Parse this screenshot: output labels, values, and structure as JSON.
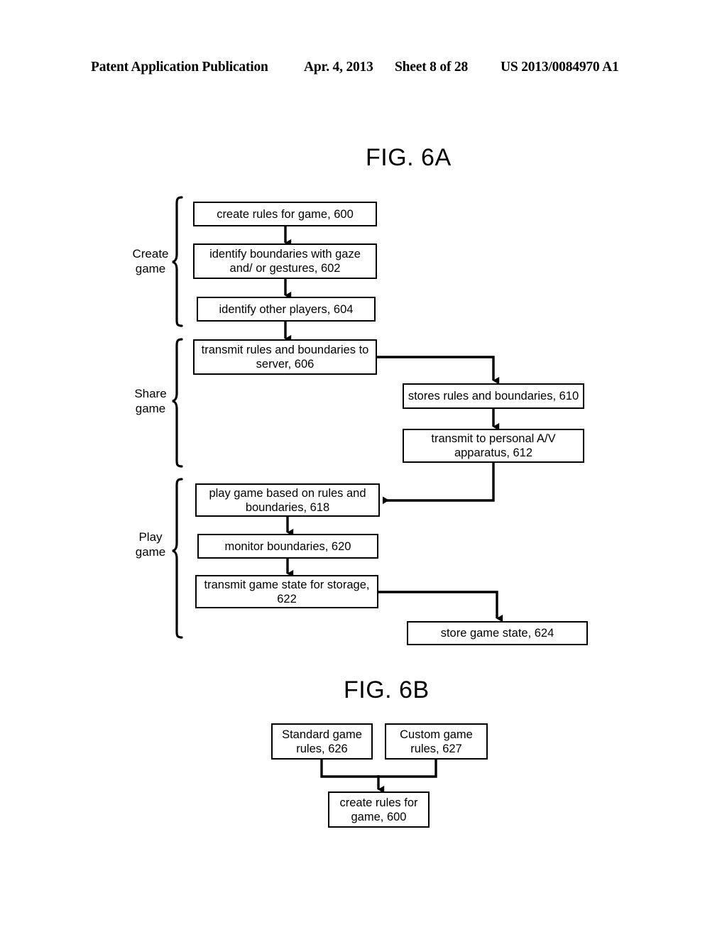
{
  "header": {
    "publication": "Patent Application Publication",
    "date": "Apr. 4, 2013",
    "sheet": "Sheet 8 of 28",
    "number": "US 2013/0084970 A1"
  },
  "figures": [
    {
      "id": "fig-6a",
      "title": "FIG. 6A",
      "groups": [
        {
          "id": "create-game",
          "label": "Create\ngame"
        },
        {
          "id": "share-game",
          "label": "Share\ngame"
        },
        {
          "id": "play-game",
          "label": "Play\ngame"
        }
      ],
      "boxes": [
        {
          "id": "box-600",
          "ref": "600",
          "text": "create rules for game, 600"
        },
        {
          "id": "box-602",
          "ref": "602",
          "text": "identify boundaries with gaze and/ or gestures, 602"
        },
        {
          "id": "box-604",
          "ref": "604",
          "text": "identify other players, 604"
        },
        {
          "id": "box-606",
          "ref": "606",
          "text": "transmit rules and boundaries to server, 606"
        },
        {
          "id": "box-610",
          "ref": "610",
          "text": "stores rules and boundaries, 610"
        },
        {
          "id": "box-612",
          "ref": "612",
          "text": "transmit to personal A/V apparatus, 612"
        },
        {
          "id": "box-618",
          "ref": "618",
          "text": "play game based on rules and boundaries, 618"
        },
        {
          "id": "box-620",
          "ref": "620",
          "text": "monitor boundaries, 620"
        },
        {
          "id": "box-622",
          "ref": "622",
          "text": "transmit game state for storage, 622"
        },
        {
          "id": "box-624",
          "ref": "624",
          "text": "store game state, 624"
        }
      ]
    },
    {
      "id": "fig-6b",
      "title": "FIG. 6B",
      "boxes": [
        {
          "id": "box-626",
          "ref": "626",
          "text": "Standard game rules, 626"
        },
        {
          "id": "box-627",
          "ref": "627",
          "text": "Custom game rules, 627"
        },
        {
          "id": "box-600b",
          "ref": "600",
          "text": "create rules for game, 600"
        }
      ]
    }
  ],
  "colors": {
    "ink": "#000000",
    "paper": "#ffffff"
  }
}
